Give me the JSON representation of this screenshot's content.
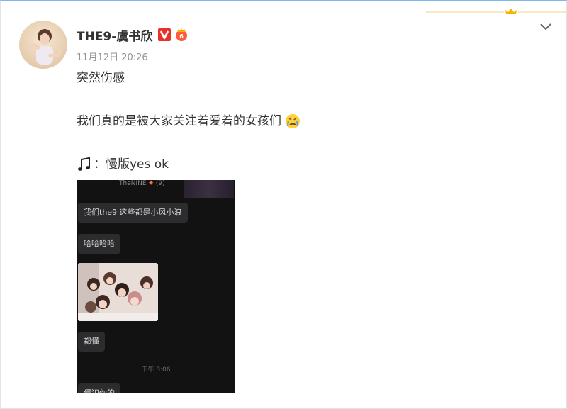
{
  "post": {
    "author": "THE9-虞书欣",
    "time": "11月12日 20:26",
    "line1": "突然伤感",
    "line2": "我们真的是被大家关注着爱着的女孩们",
    "line3_prefix": "：",
    "line3_text": "慢版yes ok",
    "icons": {
      "verified": "v-verified-icon",
      "member": "member-crown-icon",
      "emoji": "crying-emoji",
      "music": "music-note-icon",
      "collapse": "chevron-down-icon"
    }
  },
  "chat_screenshot": {
    "header": "TheNINE",
    "header_count": "(9)",
    "messages": [
      "我们the9 这些都是小风小浪",
      "哈哈哈哈",
      "都懂",
      "侵犯你的"
    ],
    "time_divider": "下午 8:06"
  },
  "colors": {
    "brand_blue_top": "#7fb8e6",
    "verified_red": "#e8312a",
    "member_gold": "#f7b500",
    "text_primary": "#333333",
    "text_muted": "#939393",
    "chat_bg": "#121212",
    "bubble_bg": "#2c2c2e"
  }
}
